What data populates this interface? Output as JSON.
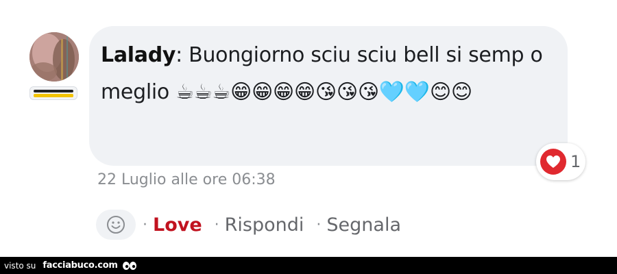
{
  "comment": {
    "author": "Lalady",
    "separator": ": ",
    "text": "Buongiorno sciu sciu bell si semp o meglio",
    "emojis": "☕☕☕😁😁😁😁😘😘😘🩵🩵😊😊"
  },
  "reaction": {
    "icon": "heart-icon",
    "count": "1",
    "color": "#e0292f"
  },
  "timestamp": "22 Luglio alle ore 06:38",
  "actions": {
    "react_icon": "smiley-icon",
    "separator": "·",
    "love": "Love",
    "reply": "Rispondi",
    "report": "Segnala",
    "love_color": "#c1121f"
  },
  "footer": {
    "prefix": "visto su",
    "site": "facciabuco.com",
    "logo_icon": "eyes-logo-icon"
  }
}
